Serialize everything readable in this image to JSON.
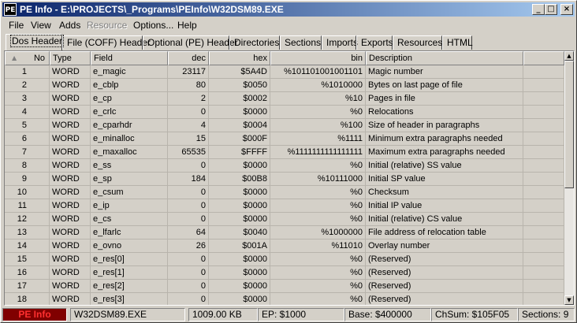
{
  "window": {
    "icon_label": "PE",
    "title": "PE Info - E:\\PROJECTS\\_Programs\\PEInfo\\W32DSM89.EXE",
    "minimize_glyph": "_",
    "maximize_glyph": "□",
    "close_glyph": "×"
  },
  "menu": [
    "File",
    "View",
    "Adds",
    "Resource",
    "Options...",
    "Help"
  ],
  "tabs": [
    "Dos Header",
    "File (COFF) Header",
    "Optional (PE) Header",
    "Directories",
    "Sections",
    "Imports",
    "Exports",
    "Resources",
    "HTML"
  ],
  "grid": {
    "sort_glyph": "▲",
    "columns": [
      "No",
      "Type",
      "Field",
      "dec",
      "hex",
      "bin",
      "Description"
    ],
    "rows": [
      [
        "1",
        "WORD",
        "e_magic",
        "23117",
        "$5A4D",
        "%101101001001101",
        "Magic number"
      ],
      [
        "2",
        "WORD",
        "e_cblp",
        "80",
        "$0050",
        "%1010000",
        "Bytes on last page of file"
      ],
      [
        "3",
        "WORD",
        "e_cp",
        "2",
        "$0002",
        "%10",
        "Pages in file"
      ],
      [
        "4",
        "WORD",
        "e_crlc",
        "0",
        "$0000",
        "%0",
        "Relocations"
      ],
      [
        "5",
        "WORD",
        "e_cparhdr",
        "4",
        "$0004",
        "%100",
        "Size of header in paragraphs"
      ],
      [
        "6",
        "WORD",
        "e_minalloc",
        "15",
        "$000F",
        "%1111",
        "Minimum extra paragraphs needed"
      ],
      [
        "7",
        "WORD",
        "e_maxalloc",
        "65535",
        "$FFFF",
        "%1111111111111111",
        "Maximum extra paragraphs needed"
      ],
      [
        "8",
        "WORD",
        "e_ss",
        "0",
        "$0000",
        "%0",
        "Initial (relative) SS value"
      ],
      [
        "9",
        "WORD",
        "e_sp",
        "184",
        "$00B8",
        "%10111000",
        "Initial SP value"
      ],
      [
        "10",
        "WORD",
        "e_csum",
        "0",
        "$0000",
        "%0",
        "Checksum"
      ],
      [
        "11",
        "WORD",
        "e_ip",
        "0",
        "$0000",
        "%0",
        "Initial IP value"
      ],
      [
        "12",
        "WORD",
        "e_cs",
        "0",
        "$0000",
        "%0",
        "Initial (relative) CS value"
      ],
      [
        "13",
        "WORD",
        "e_lfarlc",
        "64",
        "$0040",
        "%1000000",
        "File address of relocation table"
      ],
      [
        "14",
        "WORD",
        "e_ovno",
        "26",
        "$001A",
        "%11010",
        "Overlay number"
      ],
      [
        "15",
        "WORD",
        "e_res[0]",
        "0",
        "$0000",
        "%0",
        "(Reserved)"
      ],
      [
        "16",
        "WORD",
        "e_res[1]",
        "0",
        "$0000",
        "%0",
        "(Reserved)"
      ],
      [
        "17",
        "WORD",
        "e_res[2]",
        "0",
        "$0000",
        "%0",
        "(Reserved)"
      ],
      [
        "18",
        "WORD",
        "e_res[3]",
        "0",
        "$0000",
        "%0",
        "(Reserved)"
      ]
    ]
  },
  "status": {
    "brand": "PE Info",
    "file": "W32DSM89.EXE",
    "size": "1009.00 KB",
    "ep": "EP: $1000",
    "base": "Base: $400000",
    "checksum": "ChSum: $105F05",
    "sections": "Sections: 9"
  }
}
